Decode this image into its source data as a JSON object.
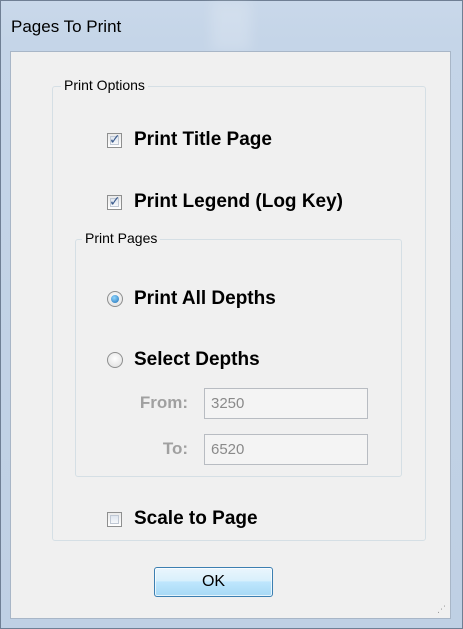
{
  "window": {
    "title": "Pages To Print"
  },
  "print_options": {
    "legend": "Print Options",
    "print_title_page": {
      "label": "Print Title Page",
      "checked": true
    },
    "print_legend": {
      "label": "Print Legend (Log Key)",
      "checked": true
    },
    "scale_to_page": {
      "label": "Scale to Page",
      "checked": false
    }
  },
  "print_pages": {
    "legend": "Print Pages",
    "print_all_depths": {
      "label": "Print All Depths",
      "selected": true
    },
    "select_depths": {
      "label": "Select Depths",
      "selected": false
    },
    "from": {
      "label": "From:",
      "value": "3250"
    },
    "to": {
      "label": "To:",
      "value": "6520"
    }
  },
  "buttons": {
    "ok_label": "OK"
  },
  "icons": {
    "checkmark": "✓",
    "grip": "⋰"
  },
  "colors": {
    "radio_selected": "#1f6fb5",
    "disabled_text": "#a0a0a0"
  }
}
